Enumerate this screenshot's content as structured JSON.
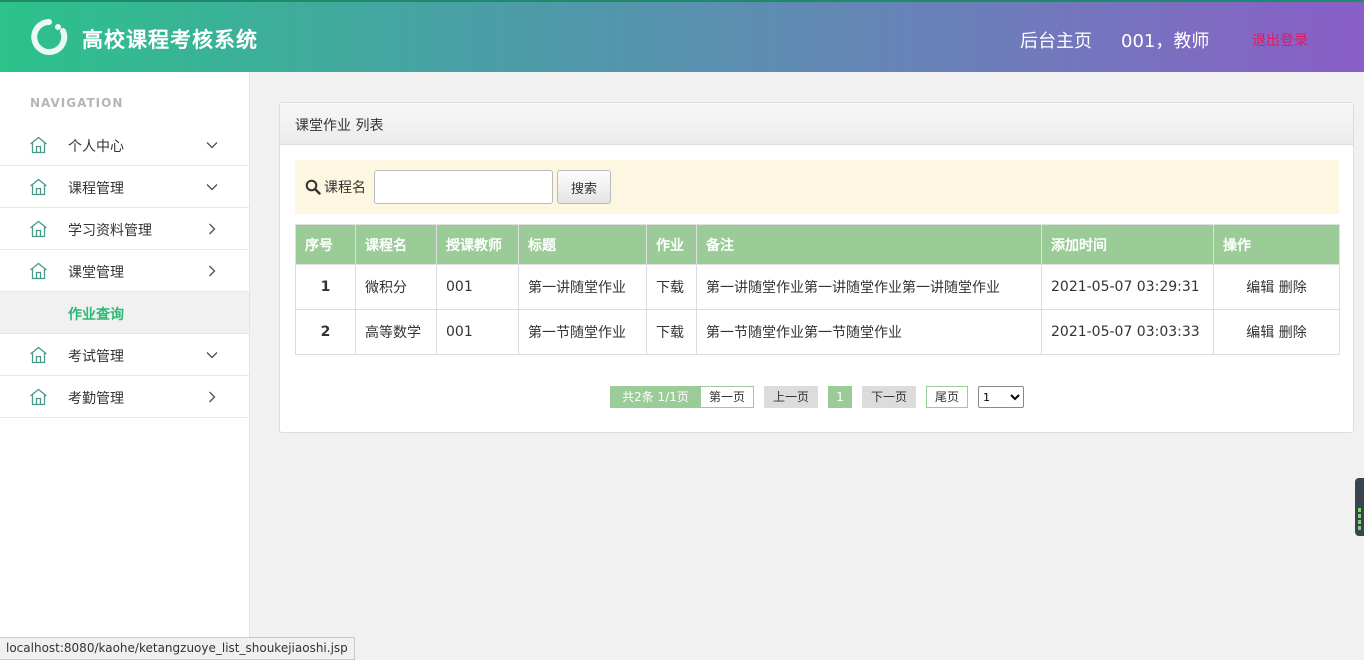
{
  "header": {
    "app_title": "高校课程考核系统",
    "home_link": "后台主页",
    "user": "001，教师",
    "logout": "退出登录",
    "accent_color": "#2cc28a"
  },
  "sidebar": {
    "heading": "NAVIGATION",
    "items": [
      {
        "label": "个人中心",
        "icon": "home-icon",
        "chevron": "chevron-down-icon"
      },
      {
        "label": "课程管理",
        "icon": "home-icon",
        "chevron": "chevron-down-icon"
      },
      {
        "label": "学习资料管理",
        "icon": "home-icon",
        "chevron": "chevron-right-icon"
      },
      {
        "label": "课堂管理",
        "icon": "home-icon",
        "chevron": "chevron-right-icon"
      },
      {
        "label": "考试管理",
        "icon": "home-icon",
        "chevron": "chevron-down-icon"
      },
      {
        "label": "考勤管理",
        "icon": "home-icon",
        "chevron": "chevron-right-icon"
      }
    ],
    "active_sub": "作业查询",
    "active_color": "#2cb877"
  },
  "panel": {
    "title": "课堂作业 列表"
  },
  "search": {
    "label": "课程名",
    "value": "",
    "placeholder": "",
    "button": "搜索"
  },
  "table": {
    "columns": [
      "序号",
      "课程名",
      "授课教师",
      "标题",
      "作业",
      "备注",
      "添加时间",
      "操作"
    ],
    "rows": [
      {
        "idx": "1",
        "course": "微积分",
        "teacher": "001",
        "title": "第一讲随堂作业",
        "file": "下载",
        "note": "第一讲随堂作业第一讲随堂作业第一讲随堂作业",
        "time": "2021-05-07 03:29:31",
        "edit": "编辑",
        "del": "删除"
      },
      {
        "idx": "2",
        "course": "高等数学",
        "teacher": "001",
        "title": "第一节随堂作业",
        "file": "下载",
        "note": "第一节随堂作业第一节随堂作业",
        "time": "2021-05-07 03:03:33",
        "edit": "编辑",
        "del": "删除"
      }
    ],
    "header_color": "#9bcc98"
  },
  "pager": {
    "info": "共2条 1/1页",
    "first": "第一页",
    "prev": "上一页",
    "current": "1",
    "next": "下一页",
    "last": "尾页",
    "select_value": "1"
  },
  "statusbar": {
    "url": "localhost:8080/kaohe/ketangzuoye_list_shoukejiaoshi.jsp"
  }
}
